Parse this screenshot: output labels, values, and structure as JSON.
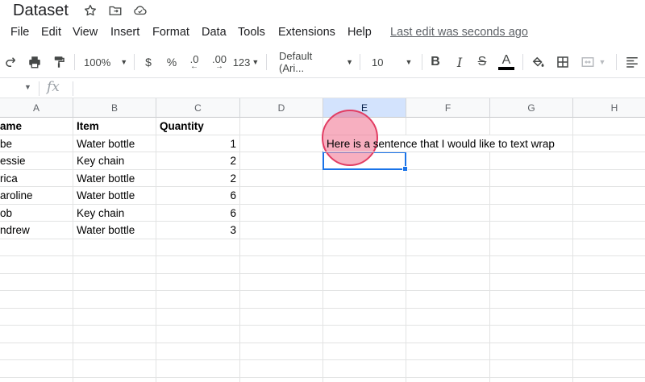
{
  "document": {
    "title": "Dataset"
  },
  "title_icons": [
    {
      "name": "star-icon"
    },
    {
      "name": "move-folder-icon"
    },
    {
      "name": "cloud-saved-icon"
    }
  ],
  "menu": {
    "items": [
      "File",
      "Edit",
      "View",
      "Insert",
      "Format",
      "Data",
      "Tools",
      "Extensions",
      "Help"
    ],
    "last_edit": "Last edit was seconds ago"
  },
  "toolbar": {
    "zoom": "100%",
    "currency": "$",
    "percent": "%",
    "decrease_decimal": ".0",
    "increase_decimal": ".00",
    "more_formats": "123",
    "font_family": "Default (Ari...",
    "font_size": "10",
    "bold": "B",
    "italic": "I",
    "strike": "S",
    "text_color": "A"
  },
  "sheet": {
    "columns": [
      "A",
      "B",
      "C",
      "D",
      "E",
      "F",
      "G",
      "H"
    ],
    "active_column": "E",
    "header_row": [
      "ame",
      "Item",
      "Quantity"
    ],
    "rows": [
      {
        "a": "be",
        "b": "Water bottle",
        "c": "1"
      },
      {
        "a": "essie",
        "b": "Key chain",
        "c": "2"
      },
      {
        "a": "rica",
        "b": "Water bottle",
        "c": "2"
      },
      {
        "a": "aroline",
        "b": "Water bottle",
        "c": "6"
      },
      {
        "a": "ob",
        "b": "Key chain",
        "c": "6"
      },
      {
        "a": "ndrew",
        "b": "Water bottle",
        "c": "3"
      }
    ],
    "e2_text": "Here is a sentence that I would like to text wrap"
  },
  "colors": {
    "selection": "#1a73e8",
    "active_header": "#d3e3fd",
    "click_indicator": "#e23d63"
  }
}
